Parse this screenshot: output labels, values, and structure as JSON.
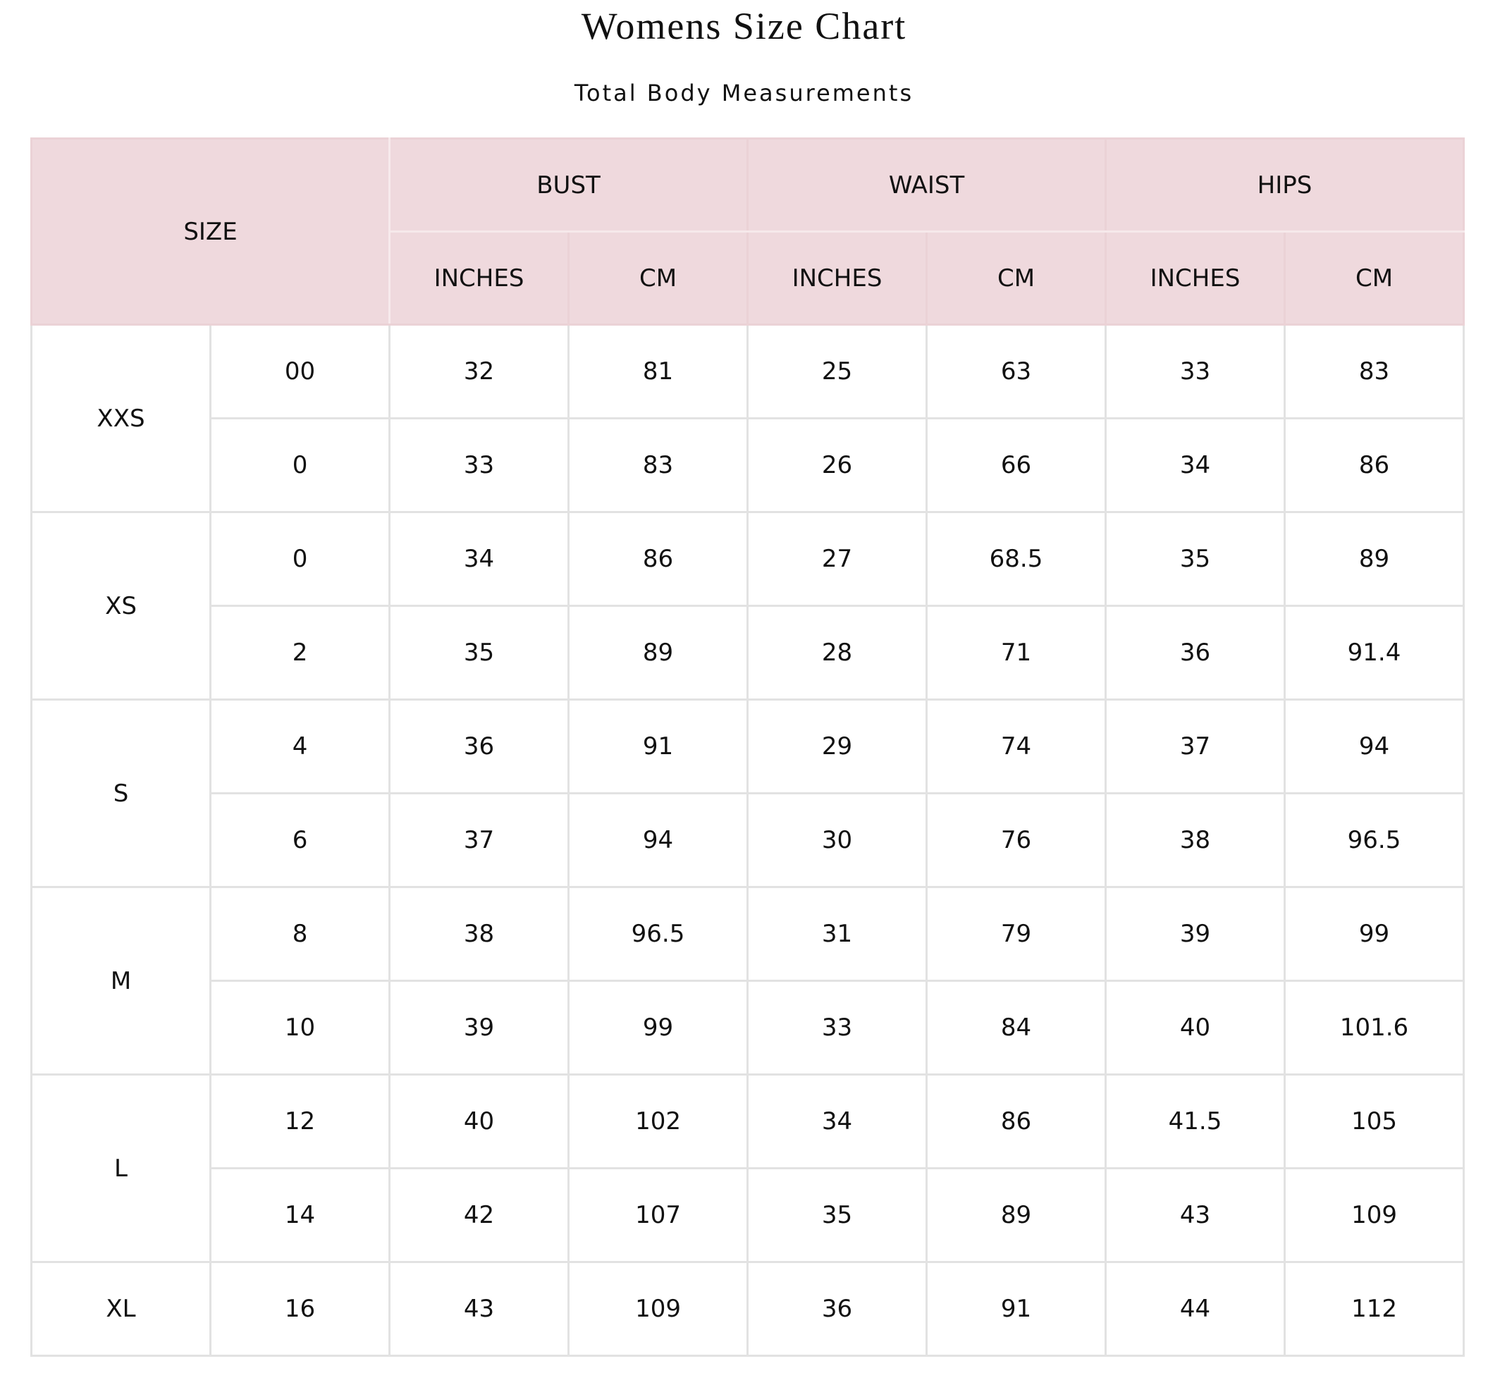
{
  "title": "Womens Size Chart",
  "subtitle": "Total Body Measurements",
  "table": {
    "size_header": "SIZE",
    "groups": [
      "BUST",
      "WAIST",
      "HIPS"
    ],
    "units": [
      "INCHES",
      "CM",
      "INCHES",
      "CM",
      "INCHES",
      "CM"
    ],
    "rows": [
      {
        "size": "XXS",
        "num": "00",
        "values": [
          "32",
          "81",
          "25",
          "63",
          "33",
          "83"
        ]
      },
      {
        "size": "XXS",
        "num": "0",
        "values": [
          "33",
          "83",
          "26",
          "66",
          "34",
          "86"
        ]
      },
      {
        "size": "XS",
        "num": "0",
        "values": [
          "34",
          "86",
          "27",
          "68.5",
          "35",
          "89"
        ]
      },
      {
        "size": "XS",
        "num": "2",
        "values": [
          "35",
          "89",
          "28",
          "71",
          "36",
          "91.4"
        ]
      },
      {
        "size": "S",
        "num": "4",
        "values": [
          "36",
          "91",
          "29",
          "74",
          "37",
          "94"
        ]
      },
      {
        "size": "S",
        "num": "6",
        "values": [
          "37",
          "94",
          "30",
          "76",
          "38",
          "96.5"
        ]
      },
      {
        "size": "M",
        "num": "8",
        "values": [
          "38",
          "96.5",
          "31",
          "79",
          "39",
          "99"
        ]
      },
      {
        "size": "M",
        "num": "10",
        "values": [
          "39",
          "99",
          "33",
          "84",
          "40",
          "101.6"
        ]
      },
      {
        "size": "L",
        "num": "12",
        "values": [
          "40",
          "102",
          "34",
          "86",
          "41.5",
          "105"
        ]
      },
      {
        "size": "L",
        "num": "14",
        "values": [
          "42",
          "107",
          "35",
          "89",
          "43",
          "109"
        ]
      },
      {
        "size": "XL",
        "num": "16",
        "values": [
          "43",
          "109",
          "36",
          "91",
          "44",
          "112"
        ]
      }
    ]
  },
  "colors": {
    "header_background": "#efd9dd",
    "border": "#e2e2e2",
    "text": "#111111"
  }
}
